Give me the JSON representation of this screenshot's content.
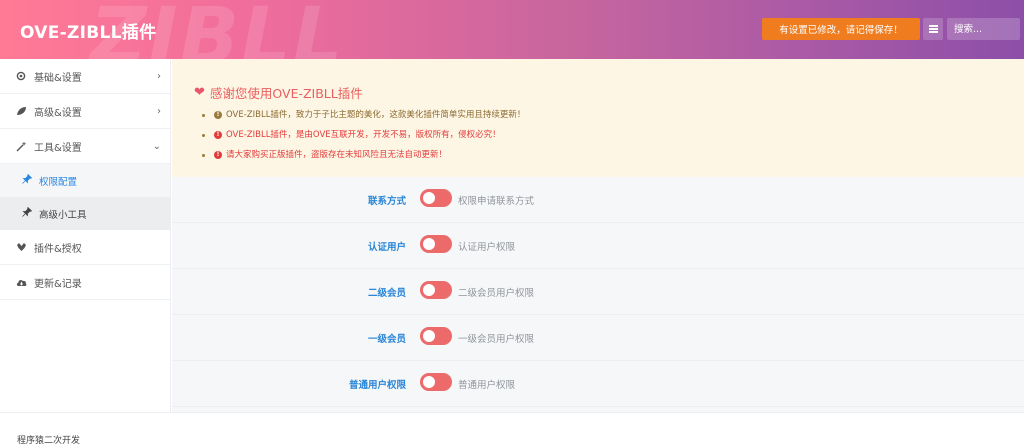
{
  "header": {
    "brand": "OVE-ZIBLL插件",
    "watermark": "ZIBLL",
    "save_notice": "有设置已修改，请记得保存！",
    "list_icon": "list-icon",
    "search_placeholder": "搜索..."
  },
  "sidebar": {
    "items": [
      {
        "icon": "gear-icon",
        "label": "基础&设置",
        "arrow": "›"
      },
      {
        "icon": "leaf-icon",
        "label": "高级&设置",
        "arrow": "›"
      },
      {
        "icon": "magic-wand-icon",
        "label": "工具&设置",
        "arrow": "⌄"
      },
      {
        "icon": "plugin-icon",
        "label": "插件&授权"
      },
      {
        "icon": "cloud-icon",
        "label": "更新&记录"
      }
    ],
    "sub_items": [
      {
        "icon": "pin-icon",
        "label": "权限配置"
      },
      {
        "icon": "pin-icon",
        "label": "高级小工具"
      }
    ]
  },
  "notice": {
    "title": "感谢您使用OVE-ZIBLL插件",
    "items": [
      "OVE-ZIBLL插件，致力于子比主题的美化，这款美化插件简单实用且持续更新！",
      "OVE-ZIBLL插件，是由OVE互联开发，开发不易，版权所有，侵权必究！",
      "请大家购买正版插件，盗版存在未知风险且无法自动更新！"
    ]
  },
  "settings": [
    {
      "label": "联系方式",
      "desc": "权限申请联系方式",
      "enabled": false
    },
    {
      "label": "认证用户",
      "desc": "认证用户权限",
      "enabled": false
    },
    {
      "label": "二级会员",
      "desc": "二级会员用户权限",
      "enabled": false
    },
    {
      "label": "一级会员",
      "desc": "一级会员用户权限",
      "enabled": false
    },
    {
      "label": "普通用户权限",
      "desc": "普通用户权限",
      "enabled": false
    }
  ],
  "footer": {
    "text": "程序猿二次开发"
  },
  "colors": {
    "accent": "#2a86d6",
    "toggle": "#ec6a6a",
    "save_button": "#ef7d1f",
    "notice_bg": "#fef6e4"
  }
}
